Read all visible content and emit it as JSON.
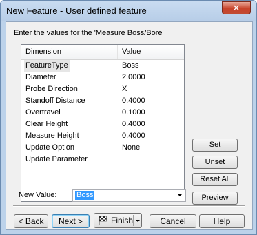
{
  "window": {
    "title": "New Feature - User defined feature",
    "close_symbol": "✕"
  },
  "instruction": "Enter the values for the 'Measure Boss/Bore'",
  "list": {
    "headers": {
      "dimension": "Dimension",
      "value": "Value"
    },
    "rows": [
      {
        "dimension": "FeatureType",
        "value": "Boss"
      },
      {
        "dimension": "Diameter",
        "value": "2.0000"
      },
      {
        "dimension": "Probe Direction",
        "value": "X"
      },
      {
        "dimension": "Standoff Distance",
        "value": "0.4000"
      },
      {
        "dimension": "Overtravel",
        "value": "0.1000"
      },
      {
        "dimension": "Clear Height",
        "value": "0.4000"
      },
      {
        "dimension": "Measure Height",
        "value": "0.4000"
      },
      {
        "dimension": "Update Option",
        "value": "None"
      },
      {
        "dimension": "Update Parameter",
        "value": ""
      }
    ]
  },
  "side_buttons": {
    "set": "Set",
    "unset": "Unset",
    "reset_all": "Reset All",
    "preview": "Preview"
  },
  "new_value": {
    "label": "New Value:",
    "value": "Boss"
  },
  "bottom_buttons": {
    "back": "< Back",
    "next": "Next >",
    "finish": "Finish",
    "cancel": "Cancel",
    "help": "Help"
  },
  "icons": {
    "close": "close-icon",
    "finish": "finish-flag-icon",
    "dropdown": "chevron-down-icon"
  }
}
